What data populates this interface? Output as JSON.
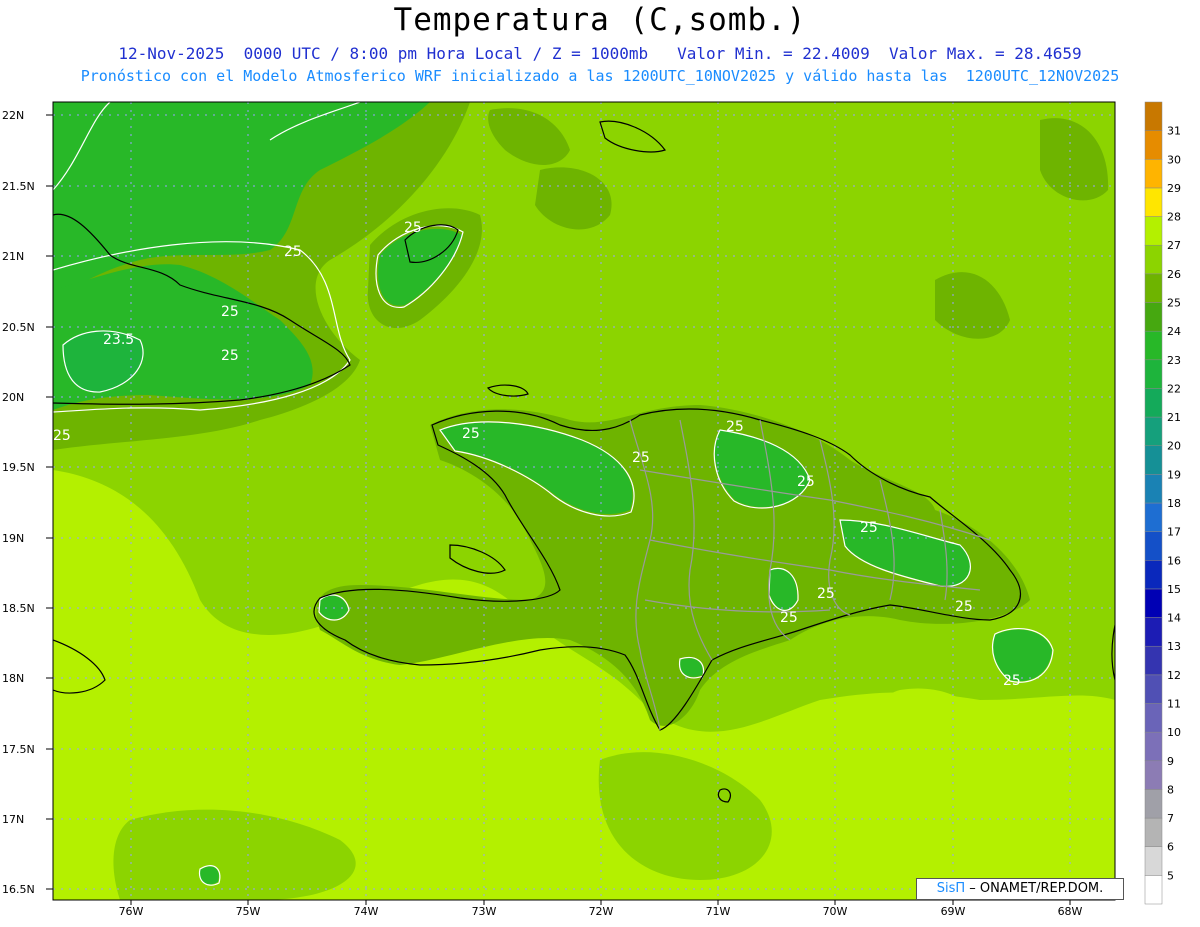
{
  "header": {
    "title": "Temperatura (C,somb.)",
    "line1": "12-Nov-2025  0000 UTC / 8:00 pm Hora Local / Z = 1000mb   Valor Min. = 22.4009  Valor Max. = 28.4659",
    "line2": "Pronóstico con el Modelo Atmosferico WRF inicializado a las 1200UTC_10NOV2025 y válido hasta las  1200UTC_12NOV2025"
  },
  "axes": {
    "lat_labels": [
      "22N",
      "21.5N",
      "21N",
      "20.5N",
      "20N",
      "19.5N",
      "19N",
      "18.5N",
      "18N",
      "17.5N",
      "17N",
      "16.5N"
    ],
    "lon_labels": [
      "76W",
      "75W",
      "74W",
      "73W",
      "72W",
      "71W",
      "70W",
      "69W",
      "68W"
    ]
  },
  "colorbar": {
    "levels": [
      "5",
      "6",
      "7",
      "8",
      "9",
      "10",
      "11",
      "12",
      "13",
      "14",
      "15",
      "16",
      "17",
      "18",
      "19",
      "20",
      "21",
      "22",
      "23",
      "24",
      "25",
      "26",
      "27",
      "28",
      "29",
      "30",
      "31"
    ],
    "colors": [
      "#ffffff",
      "#d8d8d8",
      "#b4b4b4",
      "#a0a0a8",
      "#8c7cb4",
      "#7c70b8",
      "#6a64b8",
      "#5050b4",
      "#3434b0",
      "#1c1cb4",
      "#0000b4",
      "#0a28bc",
      "#1450c8",
      "#1e6ed2",
      "#1a82b4",
      "#159096",
      "#15a07c",
      "#14aa5a",
      "#1eb43c",
      "#28b828",
      "#46a810",
      "#6eb400",
      "#8cd400",
      "#b4f000",
      "#ffe600",
      "#ffb400",
      "#e68c00",
      "#c87800"
    ]
  },
  "contour_labels": [
    "25",
    "25",
    "25",
    "25",
    "23.5",
    "25",
    "25",
    "25",
    "25",
    "25",
    "25",
    "25",
    "25",
    "25",
    "25"
  ],
  "credit": {
    "brand": "SisΠ",
    "text": " – ONAMET/REP.DOM."
  }
}
